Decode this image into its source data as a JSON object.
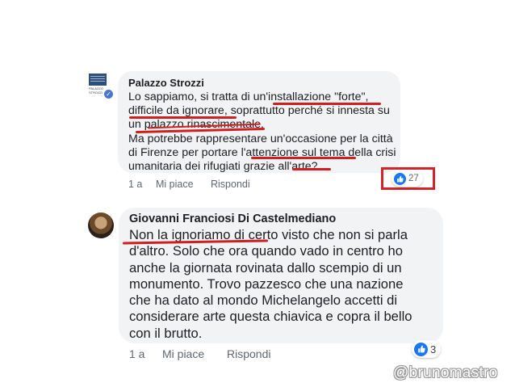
{
  "comments": [
    {
      "author": "Palazzo Strozzi",
      "avatar_text": "PALAZZO STROZZI",
      "verified_icon": "check-icon",
      "lines": [
        "Lo sappiamo, si tratta di un'installazione \"forte\",",
        "difficile da ignorare, soprattutto perché si innesta su",
        "un palazzo rinascimentale.",
        "Ma potrebbe rappresentare un'occasione per la città",
        "di Firenze per portare l'attenzione sul tema della crisi",
        "umanitaria dei rifugiati grazie all'arte?"
      ],
      "time": "1 a",
      "like_label": "Mi piace",
      "reply_label": "Rispondi",
      "reaction_icon": "thumbs-up-icon",
      "reaction_count": "27"
    },
    {
      "author": "Giovanni Franciosi Di Castelmediano",
      "lines": [
        "Non la ignoriamo di certo visto che non si parla",
        "d'altro. Solo che ora quando vado in centro ho",
        "anche la giornata rovinata dallo scempio di un",
        "monumento. Trovo pazzesco che una nazione",
        "che ha dato al mondo Michelangelo accetti di",
        "considerare arte questa chiavica e copra il bello",
        "con il brutto."
      ],
      "time": "1 a",
      "like_label": "Mi piace",
      "reply_label": "Rispondi",
      "reaction_icon": "thumbs-up-icon",
      "reaction_count": "3"
    }
  ],
  "watermark": "@brunomastro",
  "colors": {
    "bubble": "#f2f3f5",
    "highlight": "#d11f1f",
    "like_blue": "#1877f2",
    "meta_gray": "#606770"
  }
}
